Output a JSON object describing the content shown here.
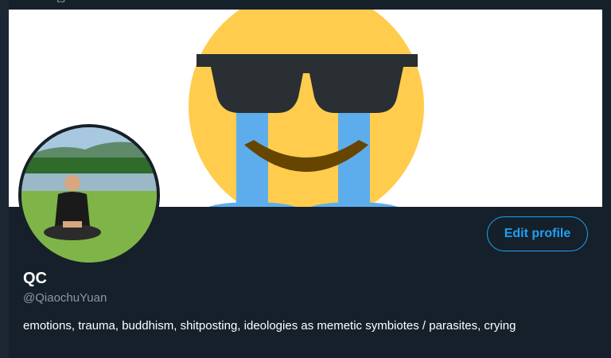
{
  "header": {
    "partial_text": "ts"
  },
  "banner": {
    "icon": "crying-sunglasses-emoji",
    "colors": {
      "face": "#ffcc4d",
      "glasses": "#292f33",
      "tears": "#5dadec",
      "smile": "#664500"
    }
  },
  "profile": {
    "avatar_icon": "profile-photo-meditating",
    "display_name": "QC",
    "handle": "@QiaochuYuan",
    "bio": "emotions, trauma, buddhism, shitposting, ideologies as memetic symbiotes / parasites, crying",
    "edit_profile_label": "Edit profile",
    "accent_color": "#1da1f2"
  }
}
